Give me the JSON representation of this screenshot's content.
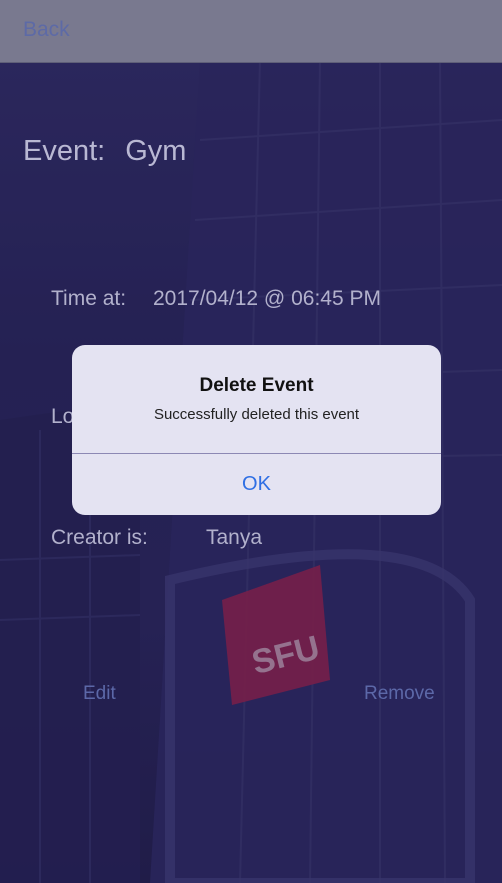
{
  "nav": {
    "back_label": "Back"
  },
  "event": {
    "label": "Event:",
    "value": "Gym"
  },
  "time": {
    "label": "Time at:",
    "value": "2017/04/12 @ 06:45 PM"
  },
  "location": {
    "label_partial": "Lo"
  },
  "creator": {
    "label": "Creator is:",
    "value": "Tanya"
  },
  "actions": {
    "edit_label": "Edit",
    "remove_label": "Remove"
  },
  "background": {
    "sign_text": "SFU"
  },
  "alert": {
    "title": "Delete Event",
    "message": "Successfully deleted this event",
    "ok_label": "OK"
  },
  "colors": {
    "link": "#5c68a8",
    "alert_button": "#2f6fe4",
    "sign": "#b2264f"
  }
}
